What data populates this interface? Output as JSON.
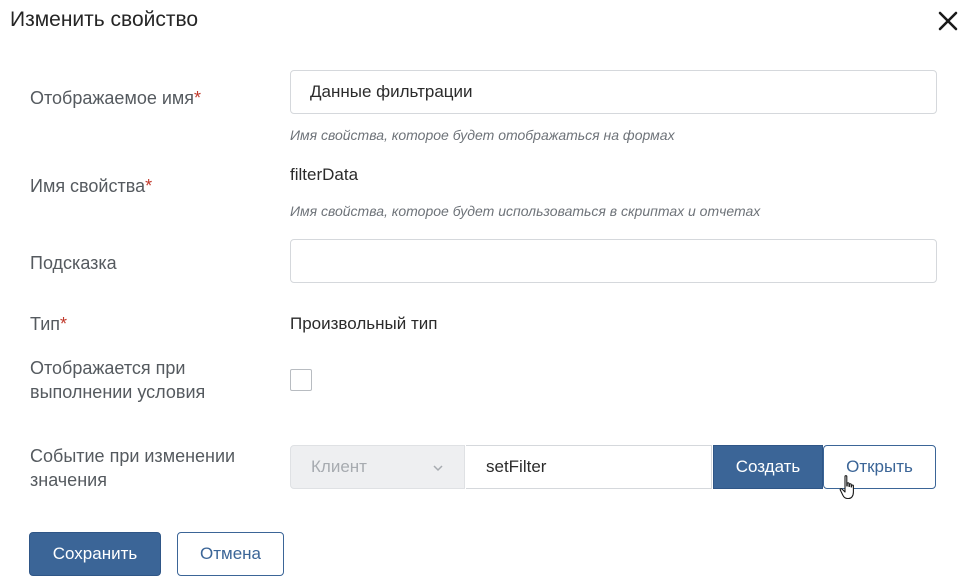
{
  "dialog": {
    "title": "Изменить свойство",
    "close_icon": "close-icon"
  },
  "fields": {
    "display_name": {
      "label": "Отображаемое имя",
      "required_mark": "*",
      "value": "Данные фильтрации",
      "hint": "Имя свойства, которое будет отображаться на формах"
    },
    "property_name": {
      "label": "Имя свойства",
      "required_mark": "*",
      "value": "filterData",
      "hint": "Имя свойства, которое будет использоваться в скриптах и отчетах"
    },
    "tooltip": {
      "label": "Подсказка",
      "value": ""
    },
    "type": {
      "label": "Тип",
      "required_mark": "*",
      "value": "Произвольный тип"
    },
    "conditional_display": {
      "label_line1": "Отображается при",
      "label_line2": "выполнении условия",
      "checked": false
    },
    "change_event": {
      "label_line1": "Событие при изменении",
      "label_line2": "значения",
      "select_value": "Клиент",
      "input_value": "setFilter",
      "create_label": "Создать",
      "open_label": "Открыть"
    }
  },
  "footer": {
    "save_label": "Сохранить",
    "cancel_label": "Отмена"
  },
  "colors": {
    "primary": "#3b6597",
    "required": "#c0392b",
    "label": "#555a5f",
    "hint": "#6e7379"
  }
}
